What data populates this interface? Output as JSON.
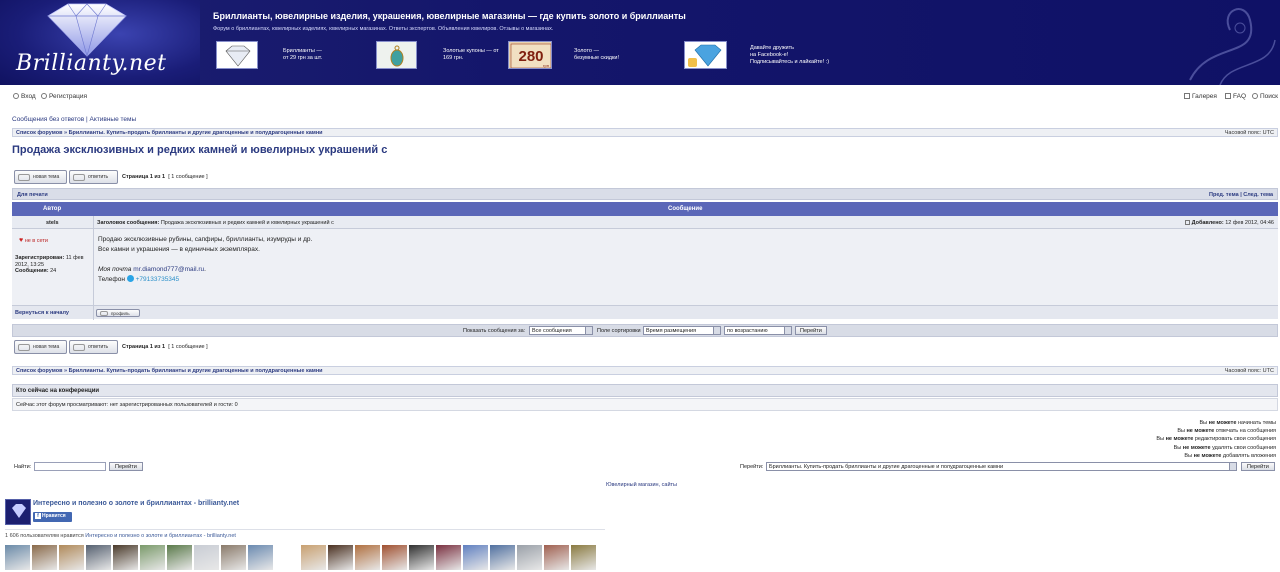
{
  "header": {
    "logo_text": "Brillianty.net",
    "title": "Бриллианты, ювелирные изделия, украшения, ювелирные магазины — где купить золото и бриллианты",
    "description": "Форум о бриллиантах, ювелирных изделиях, ювелирных магазинах. Ответы экспертов. Объявления ювелиров. Отзывы о магазинах.",
    "promos": [
      {
        "line1": "Бриллианты —",
        "line2": "от 29 грн за шт."
      },
      {
        "line1": "Золотые купоны — от",
        "line2": "169 грн."
      },
      {
        "line1": "Золото —",
        "line2": "безумные скидки!"
      },
      {
        "line1": "Давайте дружить",
        "line2": "на Facebook-е!",
        "line3": "Подписывайтесь и лайкайте! :)"
      }
    ],
    "coupon_label": "280",
    "coupon_unit": "грн"
  },
  "nav": {
    "login": "Вход",
    "register": "Регистрация",
    "gallery": "Галерея",
    "faq": "FAQ",
    "search": "Поиск",
    "unanswered": "Сообщения без ответов",
    "separator": "|",
    "active": "Активные темы"
  },
  "breadcrumb": {
    "text": "Список форумов » Бриллианты. Купить-продать бриллианты и другие драгоценные и полудрагоценные камни",
    "timezone": "Часовой пояс: UTC"
  },
  "topic": {
    "title": "Продажа эксклюзивных и редких камней и ювелирных украшений с"
  },
  "buttons": {
    "new_topic": "новая тема",
    "reply": "ответить",
    "profile": "профиль"
  },
  "pagination": {
    "page": "Страница 1 из 1",
    "count": "[ 1 сообщение ]"
  },
  "printbar": {
    "print": "Для печати",
    "prev": "Пред. тема",
    "sep": "|",
    "next": "След. тема"
  },
  "table": {
    "col_author": "Автор",
    "col_message": "Сообщение"
  },
  "post": {
    "author": "stels",
    "subject_label": "Заголовок сообщения:",
    "subject": "Продажа эксклюзивных и редких камней и ювелирных украшений с",
    "added": "Добавлено:",
    "date": "12 фев 2012, 04:46",
    "status": "не в сети",
    "registered_label": "Зарегистрирован:",
    "registered": "11 фев 2012, 13:25",
    "posts_label": "Сообщения:",
    "posts": "24",
    "line1": "Продаю эксклюзивные рубины, сапфиры, бриллианты, изумруды и др.",
    "line2": "Все камни и украшения — в единичных экземплярах.",
    "mail_label": "Моя почта",
    "mail": "mr.diamond777@mail.ru",
    "mail_end": ".",
    "phone_label": "Телефон",
    "phone": "+79133735345",
    "back_to_top": "Вернуться к началу"
  },
  "sort": {
    "show_label": "Показать сообщения за:",
    "show_value": "Все сообщения",
    "sort_label": "Поле сортировки",
    "sort_value": "Время размещения",
    "order_value": "по возрастанию",
    "go": "Перейти"
  },
  "whois": {
    "title": "Кто сейчас на конференции",
    "text": "Сейчас этот форум просматривают: нет зарегистрированных пользователей и гости: 0"
  },
  "permissions": [
    {
      "pre": "Вы",
      "bold": "не можете",
      "post": "начинать темы"
    },
    {
      "pre": "Вы",
      "bold": "не можете",
      "post": "отвечать на сообщения"
    },
    {
      "pre": "Вы",
      "bold": "не можете",
      "post": "редактировать свои сообщения"
    },
    {
      "pre": "Вы",
      "bold": "не можете",
      "post": "удалять свои сообщения"
    },
    {
      "pre": "Вы",
      "bold": "не можете",
      "post": "добавлять вложения"
    }
  ],
  "search": {
    "label": "Найти:",
    "value": "",
    "button": "Перейти"
  },
  "jump": {
    "label": "Перейти:",
    "value": "Бриллианты. Купить-продать бриллианты и другие драгоценные и полудрагоценные камни",
    "button": "Перейти"
  },
  "footer_link": "Ювелирный магазин, сайты",
  "facebook": {
    "page_name": "Интересно и полезно о золоте и бриллиантах - brillianty.net",
    "like": "Нравится",
    "count_text": "1 606 пользователям нравится",
    "count_link": "Интересно и полезно о золоте и бриллиантах - brillianty.net"
  },
  "colors": {
    "header_bg": "#14166b",
    "link": "#2b3a80",
    "table_head": "#5b67b8",
    "facebook": "#4267b2"
  }
}
